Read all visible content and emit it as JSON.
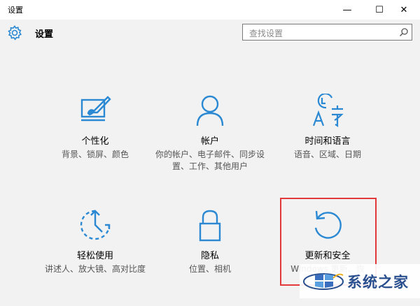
{
  "window": {
    "title": "设置",
    "minimize_glyph": "—",
    "maximize_glyph": "☐",
    "close_glyph": "✕"
  },
  "header": {
    "title": "设置",
    "icon": "gear-icon"
  },
  "search": {
    "placeholder": "查找设置",
    "icon": "search-icon"
  },
  "tiles": [
    {
      "name": "个性化",
      "description": "背景、锁屏、颜色",
      "icon": "personalization-icon"
    },
    {
      "name": "帐户",
      "description": "你的帐户、电子邮件、同步设置、工作、其他用户",
      "icon": "account-icon"
    },
    {
      "name": "时间和语言",
      "description": "语音、区域、日期",
      "icon": "time-language-icon"
    },
    {
      "name": "轻松使用",
      "description": "讲述人、放大镜、高对比度",
      "icon": "ease-of-access-icon"
    },
    {
      "name": "隐私",
      "description": "位置、相机",
      "icon": "lock-icon"
    },
    {
      "name": "更新和安全",
      "description": "Windows 更新、恢",
      "icon": "update-icon"
    }
  ],
  "watermark": {
    "text": "系统之家"
  },
  "colors": {
    "accent": "#2b89d4",
    "highlight_border": "#e23a3a",
    "watermark_text": "#2a4f8f",
    "background": "#f2f2f2"
  }
}
